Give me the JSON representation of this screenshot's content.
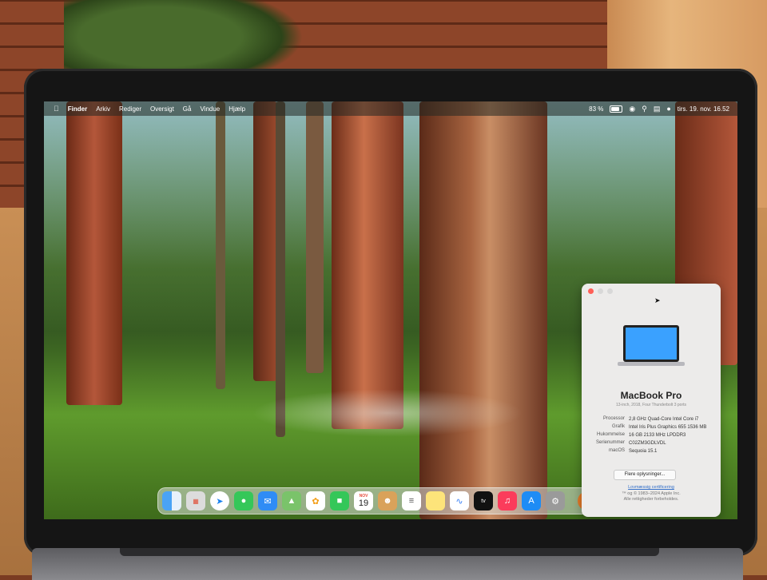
{
  "menubar": {
    "apple_icon": "apple-icon",
    "items": [
      "Finder",
      "Arkiv",
      "Rediger",
      "Oversigt",
      "Gå",
      "Vindue",
      "Hjælp"
    ],
    "battery_percent": "83 %",
    "datetime": "tirs. 19. nov.  16.52"
  },
  "about_window": {
    "model": "MacBook Pro",
    "subtitle": "13-inch, 2018, Four Thunderbolt 3 ports",
    "specs": [
      {
        "label": "Processor",
        "value": "2,8 GHz Quad-Core Intel Core i7"
      },
      {
        "label": "Grafik",
        "value": "Intel Iris Plus Graphics 655 1536 MB"
      },
      {
        "label": "Hukommelse",
        "value": "16 GB 2133 MHz LPDDR3"
      },
      {
        "label": "Serienummer",
        "value": "C02ZM3GDLVDL"
      },
      {
        "label": "macOS",
        "value": "Sequoia 15.1"
      }
    ],
    "more_info_button": "Flere oplysninger...",
    "cert_link": "Lovmæssig certificering",
    "copyright_1": "™ og © 1983–2024 Apple Inc.",
    "copyright_2": "Alle rettigheder forbeholdes."
  },
  "dock": {
    "calendar_month": "NOV",
    "calendar_day": "19",
    "apps": [
      "finder",
      "launchpad",
      "safari",
      "messages",
      "mail",
      "maps",
      "photos",
      "facetime",
      "calendar",
      "contacts",
      "reminders",
      "notes",
      "freeform",
      "tv",
      "music",
      "app-store",
      "system-settings",
      "downloads",
      "trash"
    ]
  },
  "colors": {
    "screen_menubar": "#2d332a",
    "close": "#ff5f57",
    "minimize": "#d8d8d8",
    "zoom": "#d8d8d8",
    "laptop_screen": "#3aa1ff"
  }
}
